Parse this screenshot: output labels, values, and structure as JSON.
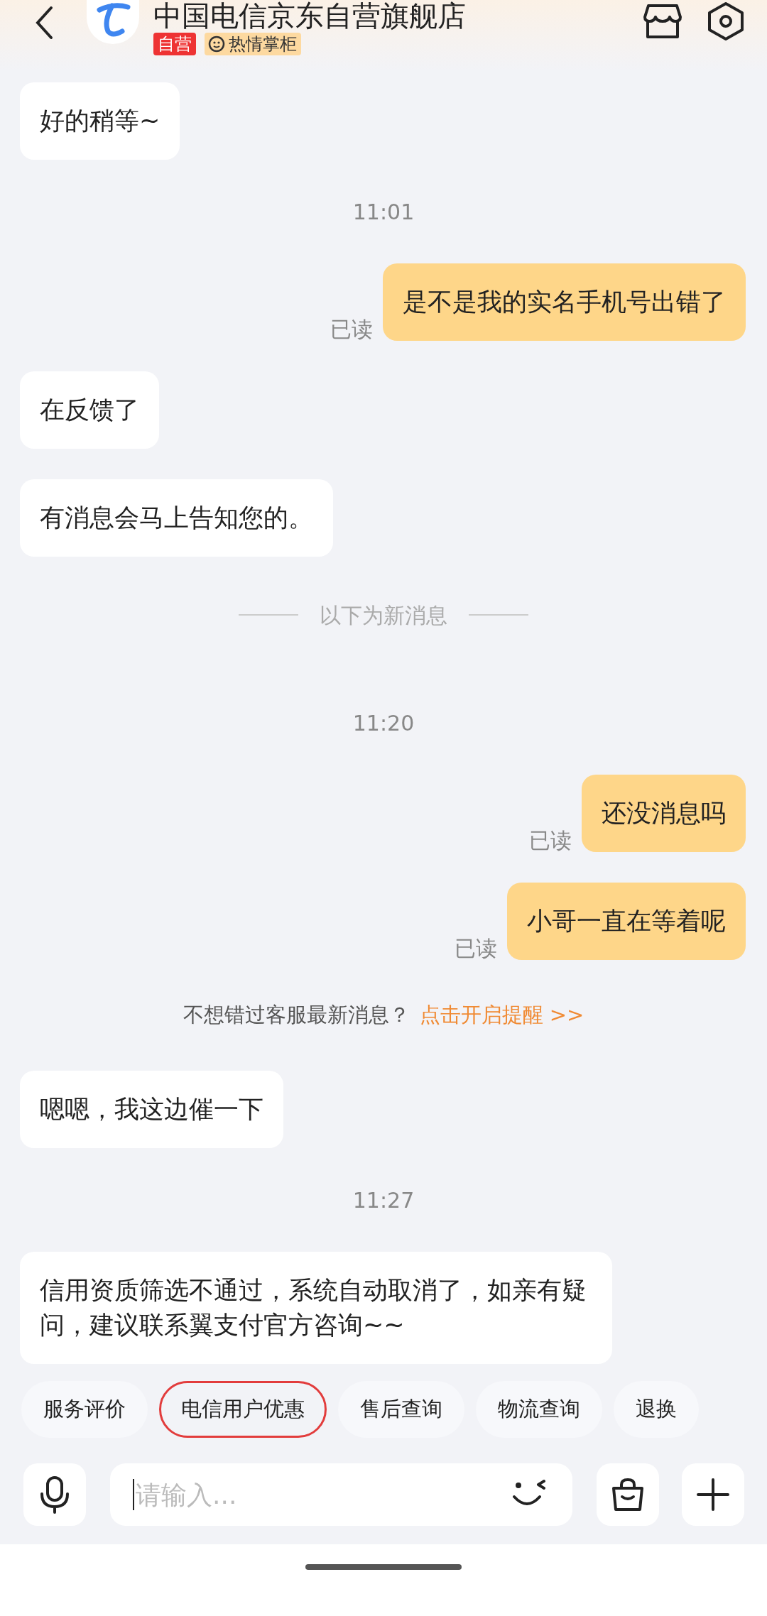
{
  "header": {
    "title": "中国电信京东自营旗舰店",
    "badges": [
      {
        "kind": "official",
        "text": "自营"
      },
      {
        "kind": "host",
        "text": "热情掌柜"
      }
    ]
  },
  "messages": [
    {
      "kind": "incoming",
      "text": "好的稍等~"
    },
    {
      "kind": "time",
      "text": "11:01"
    },
    {
      "kind": "outgoing",
      "text": "是不是我的实名手机号出错了",
      "read_label": "已读"
    },
    {
      "kind": "incoming",
      "text": "在反馈了"
    },
    {
      "kind": "incoming",
      "text": "有消息会马上告知您的。"
    },
    {
      "kind": "divider",
      "text": "以下为新消息"
    },
    {
      "kind": "time",
      "text": "11:20"
    },
    {
      "kind": "outgoing",
      "text": "还没消息吗",
      "read_label": "已读"
    },
    {
      "kind": "outgoing",
      "text": "小哥一直在等着呢",
      "read_label": "已读"
    },
    {
      "kind": "notice",
      "text": "不想错过客服最新消息？",
      "link": "点击开启提醒 >>"
    },
    {
      "kind": "incoming",
      "text": "嗯嗯，我这边催一下"
    },
    {
      "kind": "time",
      "text": "11:27"
    },
    {
      "kind": "incoming",
      "text": "信用资质筛选不通过，系统自动取消了，如亲有疑问，建议联系翼支付官方咨询~~"
    }
  ],
  "quick_replies": [
    {
      "label": "服务评价",
      "selected": false
    },
    {
      "label": "电信用户优惠",
      "selected": true
    },
    {
      "label": "售后查询",
      "selected": false
    },
    {
      "label": "物流查询",
      "selected": false
    },
    {
      "label": "退换",
      "selected": false
    }
  ],
  "input": {
    "placeholder": "请输入..."
  }
}
